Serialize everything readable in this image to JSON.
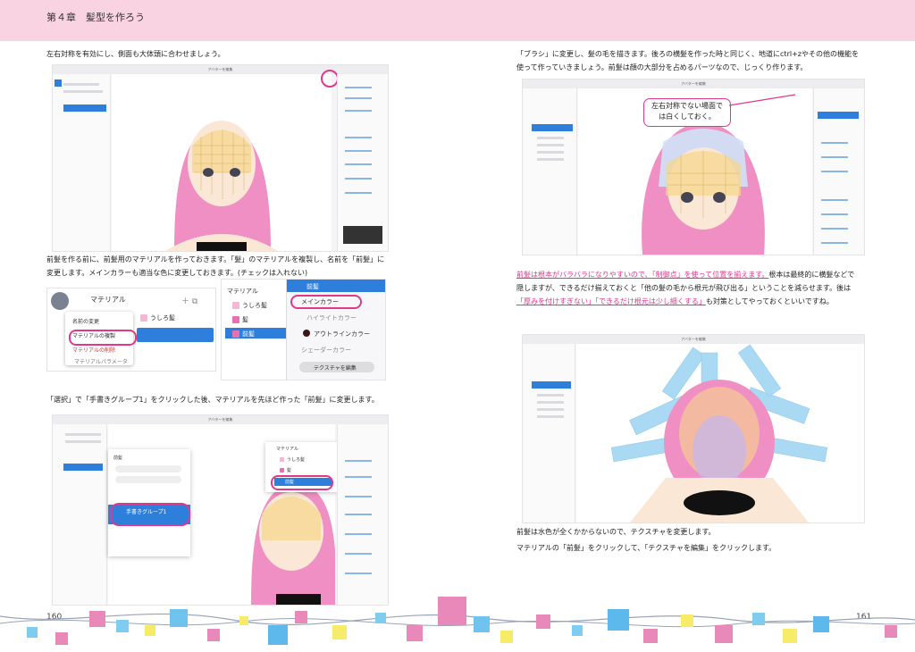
{
  "header": {
    "chapter_title": "第４章　髪型を作ろう"
  },
  "left_page": {
    "p1": "左右対称を有効にし、側面も大体頭に合わせましょう。",
    "p2_line1": "前髪を作る前に、前髪用のマテリアルを作っておきます。「髪」のマテリアルを複製し、名前を「前髪」に",
    "p2_line2": "変更します。メインカラーも適当な色に変更しておきます。(チェックは入れない)",
    "p3": "「選択」で「手書きグループ1」をクリックした後、マテリアルを先ほど作った「前髪」に変更します。",
    "page_number": "160"
  },
  "right_page": {
    "p1_line1": "「ブラシ」に変更し、髪の毛を描きます。後ろの横髪を作った時と同じく、地道にctrl+zやその他の機能を",
    "p1_line2": "使って作っていきましょう。前髪は顔の大部分を占めるパーツなので、じっくり作ります。",
    "callout_line1": "左右対称でない場面で",
    "callout_line2": "は白くしておく。",
    "p2_hl1": "前髪は根本がバラバラになりやすいので、「制御点」を使って位置を揃えます。",
    "p2_rest1": "根本は最終的に横髪などで",
    "p2_line2": "隠しますが、できるだけ揃えておくと「他の髪の毛から根元が飛び出る」ということを減らせます。後は",
    "p2_hl2": "「厚みを付けすぎない」「できるだけ根元は少し細くする」",
    "p2_rest3": "も対策としてやっておくといいですね。",
    "p3": "前髪は水色が全くかからないので、テクスチャを変更します。",
    "p4": "マテリアルの「前髪」をクリックして、「テクスチャを編集」をクリックします。",
    "page_number": "161"
  },
  "screenshot_ui": {
    "window_title": "アバターを編集",
    "section_material": "マテリアル",
    "material_items": [
      "うしろ髪",
      "髪",
      "前髪"
    ],
    "main_color": "メインカラー",
    "highlight_color": "ハイライトカラー",
    "outline_color": "アウトラインカラー",
    "shader_color": "シェーダーカラー",
    "edit_texture_button": "テクスチャを編集",
    "context_rename": "名前の変更",
    "context_duplicate": "マテリアルの複製",
    "context_delete": "マテリアルの削除",
    "shader_params": "マテリアルパラメータ",
    "group_name": "手書きグループ1",
    "front_hair_label": "前髪"
  },
  "colors": {
    "header_bg": "#f9d3e1",
    "accent_pink": "#e0398b",
    "ui_blue": "#2d7fdb",
    "hair_pink": "#ef8fc4",
    "hair_blue": "#a9d9f3"
  }
}
